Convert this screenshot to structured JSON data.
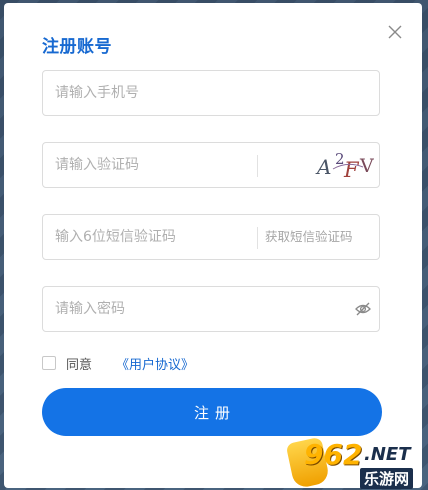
{
  "dialog": {
    "title": "注册账号",
    "close_icon": "close-icon"
  },
  "form": {
    "phone": {
      "placeholder": "请输入手机号",
      "value": ""
    },
    "captcha": {
      "placeholder": "请输入验证码",
      "value": "",
      "image_text": "A2FV"
    },
    "sms": {
      "placeholder": "输入6位短信验证码",
      "value": "",
      "button_label": "获取短信验证码"
    },
    "password": {
      "placeholder": "请输入密码",
      "value": "",
      "toggle_icon": "eye-off-icon"
    }
  },
  "agreement": {
    "checked": false,
    "label": "同意",
    "link_text": "《用户协议》"
  },
  "submit": {
    "label": "注册"
  },
  "watermark": {
    "number": "962",
    "net": ".NET",
    "site": "乐游网"
  },
  "colors": {
    "accent": "#1473e6",
    "title": "#1769d1",
    "placeholder": "#b0b0b0",
    "border": "#dcdcdc"
  }
}
